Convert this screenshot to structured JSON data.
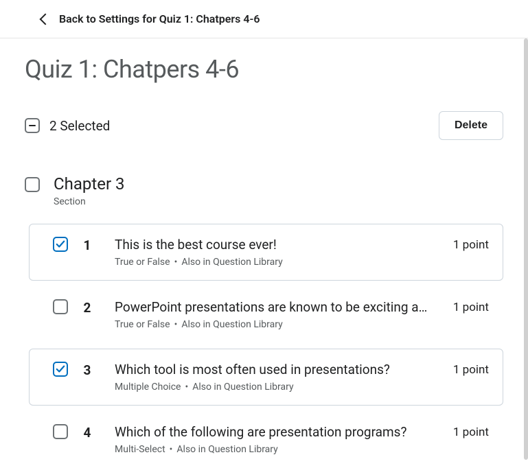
{
  "back": {
    "label": "Back to Settings for Quiz 1: Chatpers 4-6"
  },
  "page_title": "Quiz 1: Chatpers 4-6",
  "selection": {
    "count_label": "2 Selected",
    "delete_label": "Delete"
  },
  "section": {
    "title": "Chapter 3",
    "subtitle": "Section"
  },
  "questions": [
    {
      "num": "1",
      "title": "This is the best course ever!",
      "type": "True or False",
      "library": "Also in Question Library",
      "points": "1 point",
      "selected": true
    },
    {
      "num": "2",
      "title": "PowerPoint presentations are known to be exciting a…",
      "type": "True or False",
      "library": "Also in Question Library",
      "points": "1 point",
      "selected": false
    },
    {
      "num": "3",
      "title": "Which tool is most often used in presentations?",
      "type": "Multiple Choice",
      "library": "Also in Question Library",
      "points": "1 point",
      "selected": true
    },
    {
      "num": "4",
      "title": "Which of the following are presentation programs?",
      "type": "Multi-Select",
      "library": "Also in Question Library",
      "points": "1 point",
      "selected": false
    }
  ]
}
